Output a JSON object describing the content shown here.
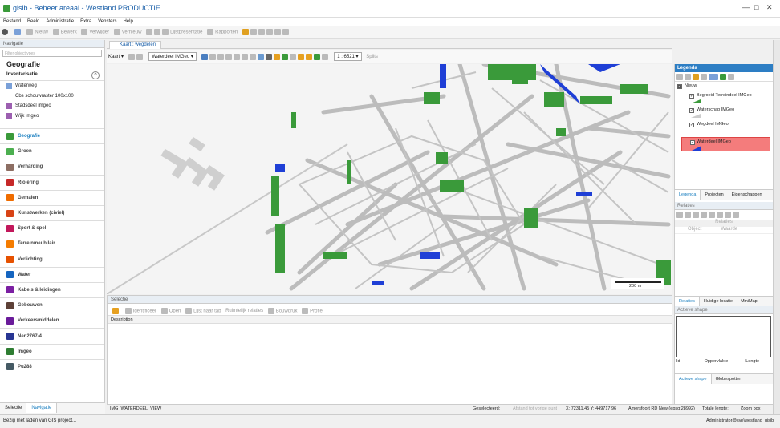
{
  "app": {
    "title": "gisib - Beheer areaal - Westland PRODUCTIE"
  },
  "menu": [
    "Bestand",
    "Beeld",
    "Administratie",
    "Extra",
    "Vensters",
    "Help"
  ],
  "toolbar": {
    "items": [
      "Nieuw",
      "Bewerk",
      "Verwijder",
      "Vernieuw",
      "Lijstpresentatie",
      "Rapporten"
    ]
  },
  "navigation": {
    "header": "Navigatie",
    "filter_placeholder": "Filter objecttypes",
    "section_title": "Geografie",
    "inventory_title": "Inventarisatie",
    "layers": [
      "Waterweg",
      "Cbs schouwraster 100x100",
      "Stadsdeel imgeo",
      "Wijk imgeo"
    ],
    "categories": [
      {
        "label": "Geografie",
        "color": "#3a9a3a"
      },
      {
        "label": "Groen",
        "color": "#4caf50"
      },
      {
        "label": "Verharding",
        "color": "#8d6e63"
      },
      {
        "label": "Riolering",
        "color": "#c62828"
      },
      {
        "label": "Gemalen",
        "color": "#ef6c00"
      },
      {
        "label": "Kunstwerken (civiel)",
        "color": "#d84315"
      },
      {
        "label": "Sport & spel",
        "color": "#c2185b"
      },
      {
        "label": "Terreinmeubilair",
        "color": "#f57c00"
      },
      {
        "label": "Verlichting",
        "color": "#e65100"
      },
      {
        "label": "Water",
        "color": "#1565c0"
      },
      {
        "label": "Kabels & leidingen",
        "color": "#7b1fa2"
      },
      {
        "label": "Gebouwen",
        "color": "#5d4037"
      },
      {
        "label": "Verkeersmiddelen",
        "color": "#6a1b9a"
      },
      {
        "label": "Nen2767-4",
        "color": "#283593"
      },
      {
        "label": "Imgeo",
        "color": "#2e7d32"
      },
      {
        "label": "Pu288",
        "color": "#455a64"
      }
    ],
    "tabs": [
      "Selectie",
      "Navigatie"
    ]
  },
  "map": {
    "tab_label": "Kaart : wegdelen",
    "kaart_label": "Kaart",
    "layer_select": "Waterdeel IMGeo",
    "scale": "1 : 6521",
    "split_label": "Splits",
    "scalebar_label": "200 m"
  },
  "selection": {
    "header": "Selectie",
    "tools": [
      "Identificeer",
      "Open",
      "Lijst naar tab",
      "Ruimtelijk relaties",
      "Bouwdruk",
      "Profiel"
    ],
    "column": "Description"
  },
  "legend": {
    "header": "Legenda",
    "root": "Nieuw",
    "items": [
      {
        "label": "Begroeid Terreindeel IMGeo",
        "selected": false
      },
      {
        "label": "Waterschap IMGeo",
        "selected": false
      },
      {
        "label": "Wegdeel IMGeo",
        "selected": false
      },
      {
        "label": "Waterdeel IMGeo",
        "selected": true
      }
    ],
    "tabs": [
      "Legenda",
      "Projecten",
      "Eigenschappen"
    ]
  },
  "relations": {
    "header": "Relaties",
    "sub": "Relaties",
    "cols": [
      "Object",
      "Waarde"
    ],
    "tabs": [
      "Relaties",
      "Huidige locatie",
      "MiniMap"
    ]
  },
  "shape": {
    "header": "Actieve shape",
    "cols": [
      "Id",
      "Oppervlakte",
      "Lengte"
    ],
    "tabs": [
      "Actieve shape",
      "Globespotter"
    ]
  },
  "mapstatus": {
    "view": "IMG_WATERDEEL_VIEW",
    "selected": "Geselecteerd:",
    "distance": "Afstand tot vorige punt",
    "coords": "X: 72311,45 Y: 449717,96",
    "crs": "Amersfoort RD New (epsg:28992)",
    "length": "Totale lengte:",
    "zoom": "Zoom box"
  },
  "status": {
    "message": "Bezig met laden van GIS project...",
    "user": "Administrator@sve\\westland_gisib"
  }
}
